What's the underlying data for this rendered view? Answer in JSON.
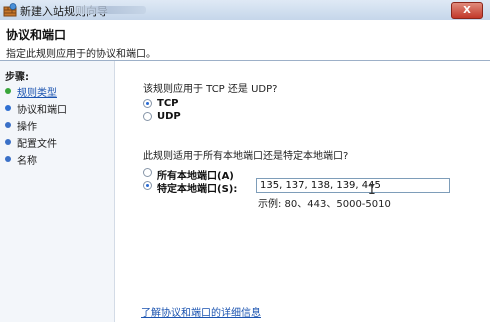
{
  "window": {
    "title": "新建入站规则向导",
    "close_label": "X",
    "colors": {
      "titlebar": "#c5d6ea",
      "close": "#c2382a",
      "link": "#1a53b0"
    }
  },
  "header": {
    "title": "协议和端口",
    "subtitle": "指定此规则应用于的协议和端口。"
  },
  "sidebar": {
    "label": "步骤:",
    "steps": [
      {
        "label": "规则类型",
        "state": "done"
      },
      {
        "label": "协议和端口",
        "state": "current"
      },
      {
        "label": "操作",
        "state": "pending"
      },
      {
        "label": "配置文件",
        "state": "pending"
      },
      {
        "label": "名称",
        "state": "pending"
      }
    ]
  },
  "protocol": {
    "question": "该规则应用于 TCP 还是 UDP?",
    "options": [
      {
        "label": "TCP",
        "selected": true
      },
      {
        "label": "UDP",
        "selected": false
      }
    ]
  },
  "ports": {
    "question": "此规则适用于所有本地端口还是特定本地端口?",
    "options": [
      {
        "label": "所有本地端口(A)",
        "selected": false
      },
      {
        "label": "特定本地端口(S):",
        "selected": true
      }
    ],
    "input_value": "135, 137, 138, 139, 445",
    "example": "示例: 80、443、5000-5010"
  },
  "footer": {
    "link": "了解协议和端口的详细信息"
  }
}
